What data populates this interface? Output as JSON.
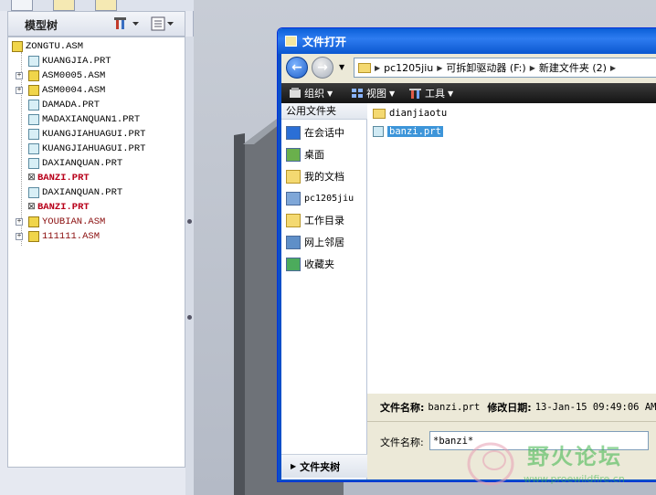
{
  "model_tree": {
    "title": "模型树",
    "items": [
      {
        "label": "ZONGTU.ASM",
        "kind": "asm",
        "expandable": false,
        "root": true,
        "red": false
      },
      {
        "label": "KUANGJIA.PRT",
        "kind": "prt",
        "expandable": false,
        "red": false
      },
      {
        "label": "ASM0005.ASM",
        "kind": "asm",
        "expandable": true,
        "red": false
      },
      {
        "label": "ASM0004.ASM",
        "kind": "asm",
        "expandable": true,
        "red": false
      },
      {
        "label": "DAMADA.PRT",
        "kind": "prt",
        "expandable": false,
        "red": false
      },
      {
        "label": "MADAXIANQUAN1.PRT",
        "kind": "prt",
        "expandable": false,
        "red": false
      },
      {
        "label": "KUANGJIAHUAGUI.PRT",
        "kind": "prt",
        "expandable": false,
        "red": false
      },
      {
        "label": "KUANGJIAHUAGUI.PRT",
        "kind": "prt",
        "expandable": false,
        "red": false
      },
      {
        "label": "DAXIANQUAN.PRT",
        "kind": "prt",
        "expandable": false,
        "red": false
      },
      {
        "label": "BANZI.PRT",
        "kind": "prt",
        "expandable": false,
        "red": true,
        "mark": "⊠"
      },
      {
        "label": "DAXIANQUAN.PRT",
        "kind": "prt",
        "expandable": false,
        "red": false
      },
      {
        "label": "BANZI.PRT",
        "kind": "prt",
        "expandable": false,
        "red": true,
        "mark": "⊠"
      },
      {
        "label": "YOUBIAN.ASM",
        "kind": "asm",
        "expandable": true,
        "red": false,
        "dark_red": true
      },
      {
        "label": "111111.ASM",
        "kind": "asm",
        "expandable": true,
        "red": false,
        "dark_red": true
      }
    ]
  },
  "dialog": {
    "title": "文件打开",
    "path": [
      "pc1205jiu",
      "可拆卸驱动器 (F:)",
      "新建文件夹 (2)"
    ],
    "toolbar": {
      "organize": "组织",
      "views": "视图",
      "tools": "工具"
    },
    "sidebar": {
      "header": "公用文件夹",
      "items": [
        "在会话中",
        "桌面",
        "我的文档",
        "pc1205jiu",
        "工作目录",
        "网上邻居",
        "收藏夹"
      ],
      "footer": "文件夹树"
    },
    "files": [
      {
        "name": "dianjiaotu",
        "type": "folder",
        "selected": false
      },
      {
        "name": "banzi.prt",
        "type": "prt",
        "selected": true
      }
    ],
    "info": {
      "name_label": "文件名称:",
      "name_value": "banzi.prt",
      "date_label": "修改日期:",
      "date_value": "13-Jan-15 09:49:06 AM"
    },
    "filename_label": "文件名称:",
    "filename_value": "*banzi*"
  },
  "watermark": {
    "text": "野火论坛",
    "url": "www.proewildfire.cn"
  }
}
